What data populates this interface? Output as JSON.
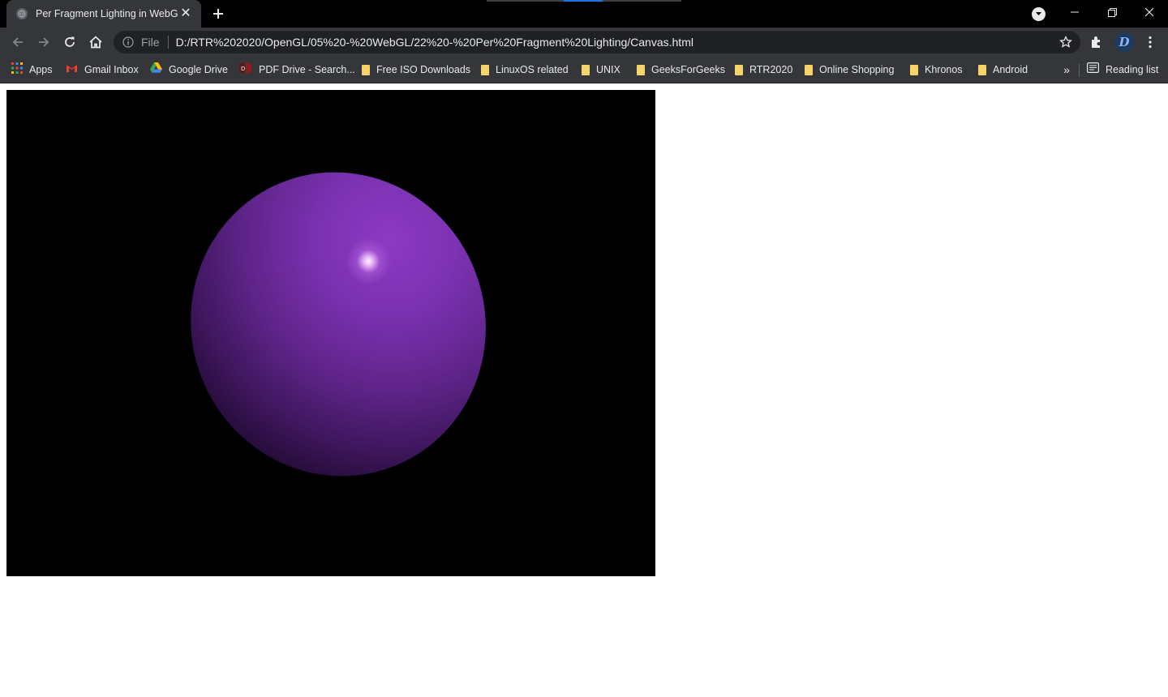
{
  "browser": {
    "tab": {
      "title": "Per Fragment Lighting in WebGL",
      "close_icon": "close-icon",
      "favicon": "globe-icon"
    },
    "window_controls": {
      "minimize": "minimize-icon",
      "restore": "restore-icon",
      "close": "close-icon"
    },
    "toolbar": {
      "scheme_label": "File",
      "url": "D:/RTR%202020/OpenGL/05%20-%20WebGL/22%20-%20Per%20Fragment%20Lighting/Canvas.html",
      "profile_initial": "D"
    },
    "bookmarks": [
      {
        "label": "Apps",
        "icon": "apps-grid-icon"
      },
      {
        "label": "Gmail Inbox",
        "icon": "gmail-icon"
      },
      {
        "label": "Google Drive",
        "icon": "google-drive-icon"
      },
      {
        "label": "PDF Drive - Search...",
        "icon": "pdf-drive-icon"
      },
      {
        "label": "Free ISO Downloads",
        "icon": "folder-icon"
      },
      {
        "label": "LinuxOS related",
        "icon": "folder-icon"
      },
      {
        "label": "UNIX",
        "icon": "folder-icon"
      },
      {
        "label": "GeeksForGeeks",
        "icon": "folder-icon"
      },
      {
        "label": "RTR2020",
        "icon": "folder-icon"
      },
      {
        "label": "Online Shopping",
        "icon": "folder-icon"
      },
      {
        "label": "Khronos",
        "icon": "folder-icon"
      },
      {
        "label": "Android",
        "icon": "folder-icon"
      }
    ],
    "more_bookmarks": "»",
    "reading_list": "Reading list"
  },
  "canvas": {
    "background": "#000000",
    "sphere_color": "#8d3ac4",
    "highlight_color": "#ffeaff"
  }
}
